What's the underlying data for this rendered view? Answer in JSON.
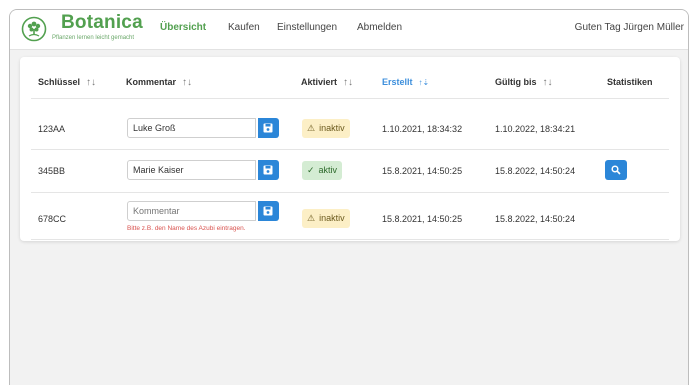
{
  "brand": {
    "name": "Botanica",
    "tagline": "Pflanzen lernen leicht gemacht",
    "color": "#52a04f"
  },
  "nav": {
    "items": [
      {
        "label": "Übersicht",
        "active": true
      },
      {
        "label": "Kaufen"
      },
      {
        "label": "Einstellungen"
      },
      {
        "label": "Abmelden"
      }
    ],
    "greeting": "Guten Tag Jürgen Müller"
  },
  "table": {
    "headers": {
      "key": "Schlüssel",
      "comment": "Kommentar",
      "activated": "Aktiviert",
      "created": "Erstellt",
      "valid_until": "Gültig bis",
      "stats": "Statistiken"
    },
    "sort_icon": "↑↓",
    "sort_active_icon": "↑⇣",
    "rows": [
      {
        "key": "123AA",
        "comment": "Luke Groß",
        "status_icon": "⚠",
        "status": "inaktiv",
        "created": "1.10.2021, 18:34:32",
        "valid_until": "1.10.2022, 18:34:21"
      },
      {
        "key": "345BB",
        "comment": "Marie Kaiser",
        "status_icon": "✓",
        "status": "aktiv",
        "created": "15.8.2021, 14:50:25",
        "valid_until": "15.8.2022, 14:50:24"
      },
      {
        "key": "678CC",
        "comment": "",
        "comment_placeholder": "Kommentar",
        "comment_hint": "Bitte z.B. den Name des Azubi eintragen.",
        "status_icon": "⚠",
        "status": "inaktiv",
        "created": "15.8.2021, 14:50:25",
        "valid_until": "15.8.2022, 14:50:24"
      }
    ]
  },
  "colors": {
    "primary": "#2b86d8",
    "sorted_header": "#3d8fdc",
    "warning_bg": "#fcefc6",
    "success_bg": "#d4ecd3",
    "error_text": "#d9534f"
  }
}
